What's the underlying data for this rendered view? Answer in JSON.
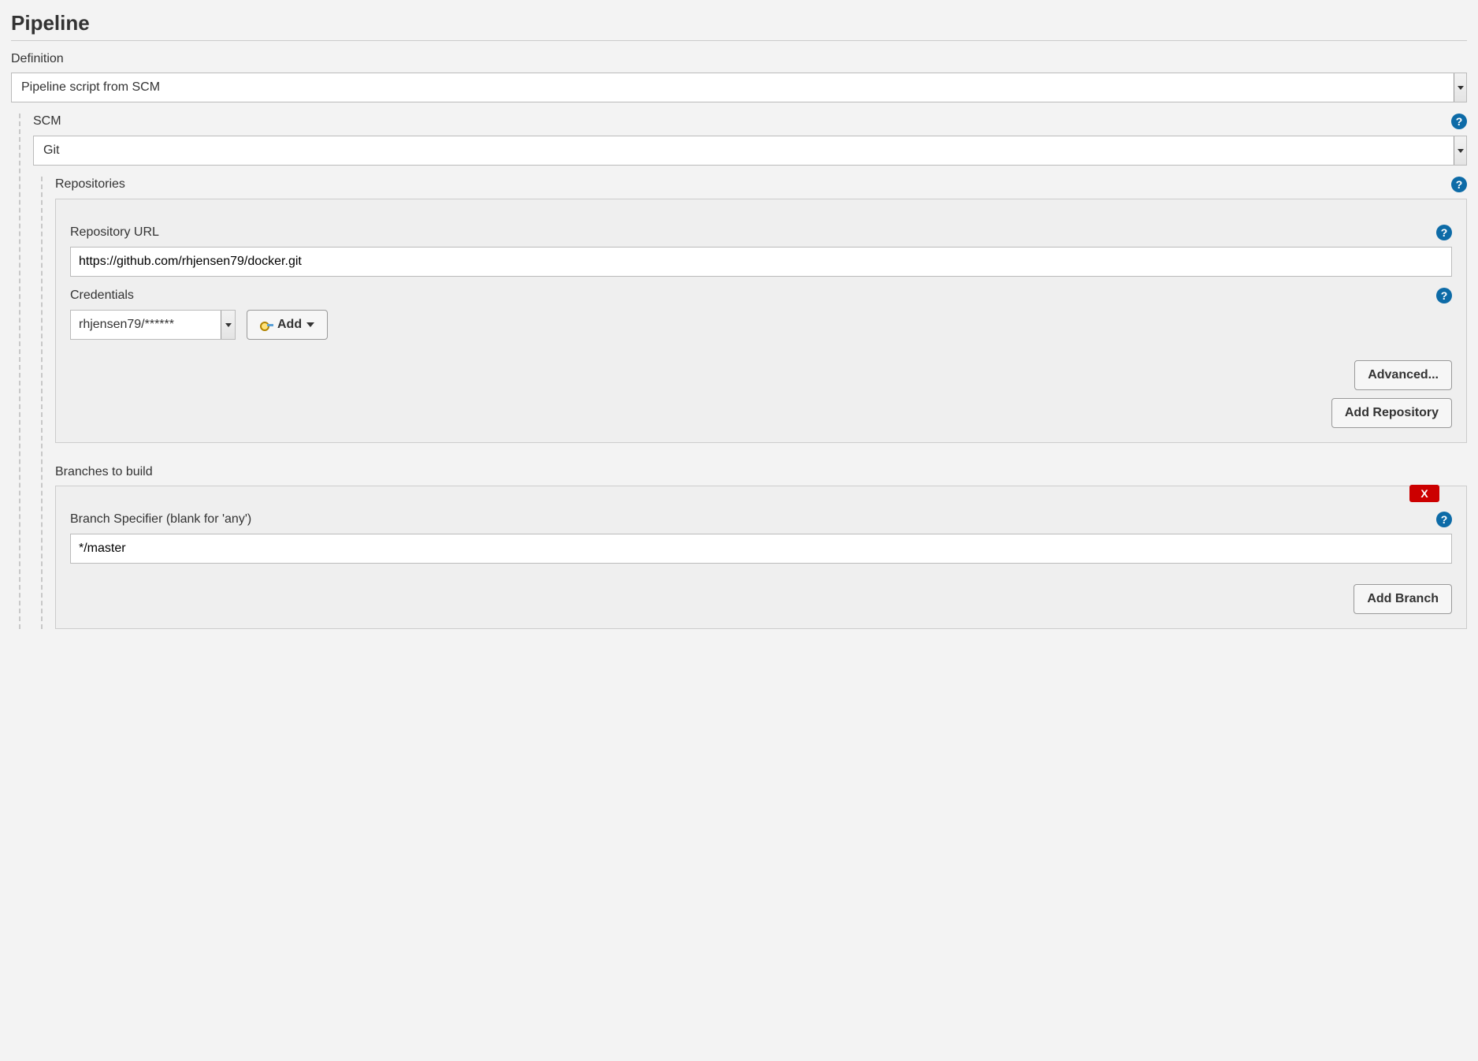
{
  "section_title": "Pipeline",
  "definition": {
    "label": "Definition",
    "value": "Pipeline script from SCM"
  },
  "scm": {
    "label": "SCM",
    "value": "Git"
  },
  "repositories": {
    "label": "Repositories",
    "repo_url_label": "Repository URL",
    "repo_url_value": "https://github.com/rhjensen79/docker.git",
    "credentials_label": "Credentials",
    "credentials_value": "rhjensen79/******",
    "add_button": "Add",
    "advanced_button": "Advanced...",
    "add_repo_button": "Add Repository"
  },
  "branches": {
    "label": "Branches to build",
    "specifier_label": "Branch Specifier (blank for 'any')",
    "specifier_value": "*/master",
    "delete_label": "X",
    "add_branch_button": "Add Branch"
  }
}
